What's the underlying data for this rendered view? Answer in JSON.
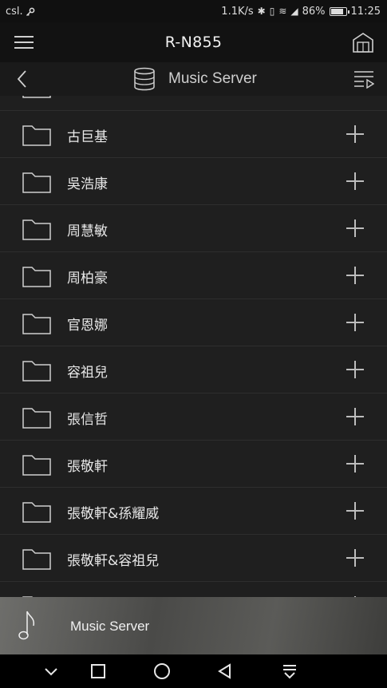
{
  "status_bar": {
    "carrier": "csl.",
    "net_speed": "1.1K/s",
    "battery_percent": "86%",
    "battery_level": 0.86,
    "time": "11:25"
  },
  "top_bar": {
    "title": "R-N855"
  },
  "nav_bar": {
    "section_title": "Music Server"
  },
  "folders": [
    {
      "label": "古巨基"
    },
    {
      "label": "吳浩康"
    },
    {
      "label": "周慧敏"
    },
    {
      "label": "周柏豪"
    },
    {
      "label": "官恩娜"
    },
    {
      "label": "容祖兒"
    },
    {
      "label": "張信哲"
    },
    {
      "label": "張敬軒"
    },
    {
      "label": "張敬軒&孫耀威"
    },
    {
      "label": "張敬軒&容祖兒"
    }
  ],
  "player": {
    "source_label": "Music Server"
  },
  "icons": {
    "menu": "hamburger-icon",
    "home": "home-icon",
    "back": "chevron-left-icon",
    "server": "database-icon",
    "queue": "playlist-icon",
    "folder": "folder-icon",
    "add": "plus-icon",
    "note": "music-note-icon"
  }
}
